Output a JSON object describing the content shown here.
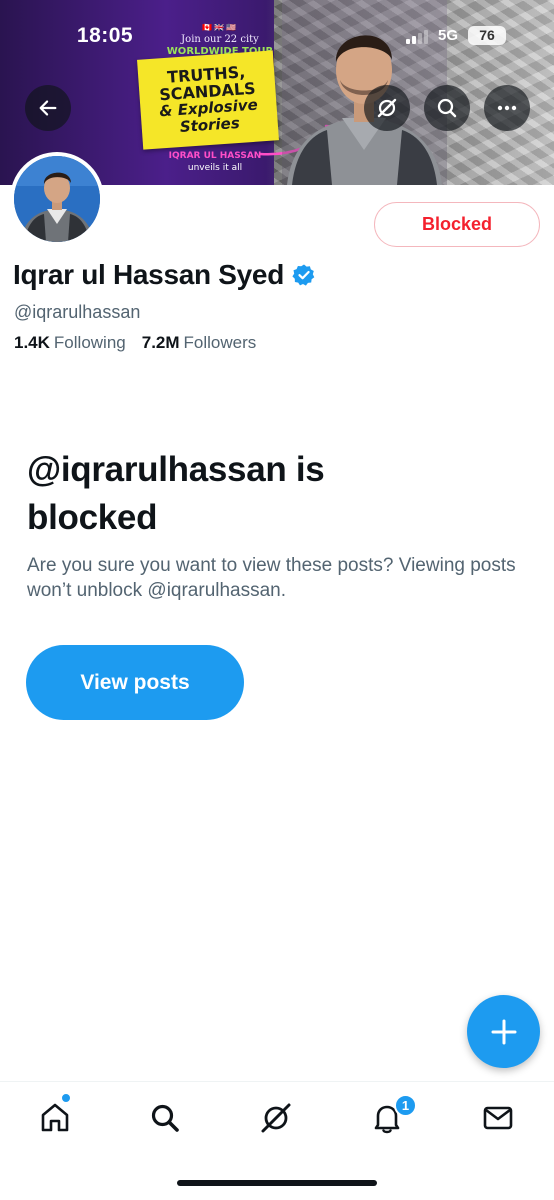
{
  "status_bar": {
    "time": "18:05",
    "network": "5G",
    "battery": "76"
  },
  "banner": {
    "flags": "🇨🇦🇬🇧🇺🇸",
    "tour_line1": "Join our 22 city",
    "tour_line2": "WORLDWIDE TOUR",
    "headline_1": "TRUTHS,",
    "headline_2": "SCANDALS",
    "headline_3": "& Explosive",
    "headline_4": "Stories",
    "byline_name": "IQRAR UL HASSAN",
    "byline_text": "unveils it all"
  },
  "header_icons": [
    "back-arrow-icon",
    "grok-icon",
    "search-icon",
    "more-icon"
  ],
  "profile": {
    "name": "Iqrar ul Hassan Syed",
    "verified": true,
    "handle": "@iqrarulhassan",
    "following_count": "1.4K",
    "following_label": "Following",
    "followers_count": "7.2M",
    "followers_label": "Followers",
    "relationship_button": "Blocked"
  },
  "blocked_notice": {
    "title": "@iqrarulhassan is blocked",
    "description": "Are you sure you want to view these posts? Viewing posts won’t unblock @iqrarulhassan.",
    "button": "View posts"
  },
  "fab_icon": "plus-icon",
  "tab_bar": {
    "tabs": [
      "home-icon",
      "search-icon",
      "grok-icon",
      "notifications-icon",
      "messages-icon"
    ],
    "notifications_badge": "1",
    "home_has_new": true
  },
  "colors": {
    "accent": "#1d9bf0",
    "blocked_red": "#f4212e",
    "text_primary": "#0f1419",
    "text_secondary": "#536471"
  }
}
